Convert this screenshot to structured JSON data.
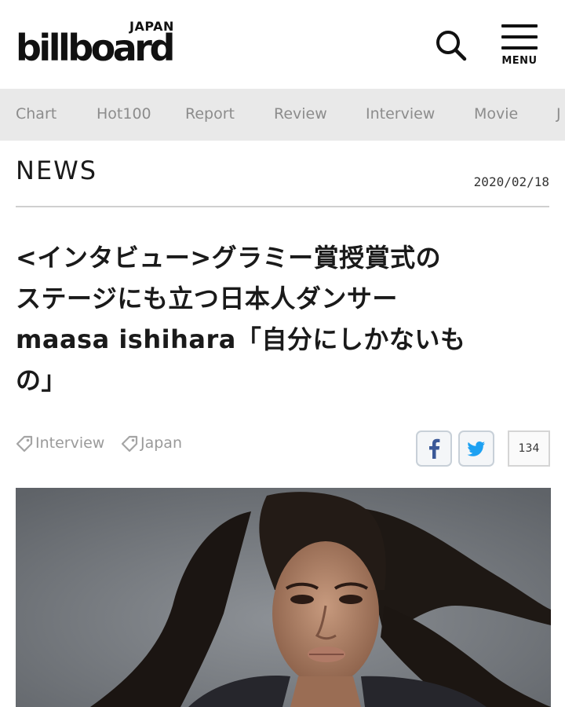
{
  "header": {
    "logo_top": "JAPAN",
    "logo_main": "billboard",
    "menu_label": "MENU",
    "search_icon": "search-icon",
    "menu_icon": "hamburger-menu-icon"
  },
  "nav": {
    "items": [
      {
        "label": "Chart"
      },
      {
        "label": "Hot100"
      },
      {
        "label": "Report"
      },
      {
        "label": "Review"
      },
      {
        "label": "Interview"
      },
      {
        "label": "Movie"
      },
      {
        "label": "J"
      }
    ]
  },
  "section": {
    "title": "NEWS",
    "date": "2020/02/18"
  },
  "article": {
    "headline_lines": [
      "<インタビュー>グラミー賞授賞式の",
      "ステージにも立つ日本人ダンサー",
      "maasa ishihara「自分にしかないも",
      "の」"
    ],
    "tags": [
      {
        "label": "Interview",
        "icon": "tag-icon"
      },
      {
        "label": "Japan",
        "icon": "tag-icon"
      }
    ],
    "share": {
      "facebook_icon": "facebook-icon",
      "twitter_icon": "twitter-icon",
      "count": "134"
    }
  },
  "colors": {
    "nav_bg": "#e9e9e9",
    "nav_text": "#8c8c8c",
    "facebook": "#3b5998",
    "twitter": "#1da1f2",
    "rule": "#cfcfcf"
  }
}
